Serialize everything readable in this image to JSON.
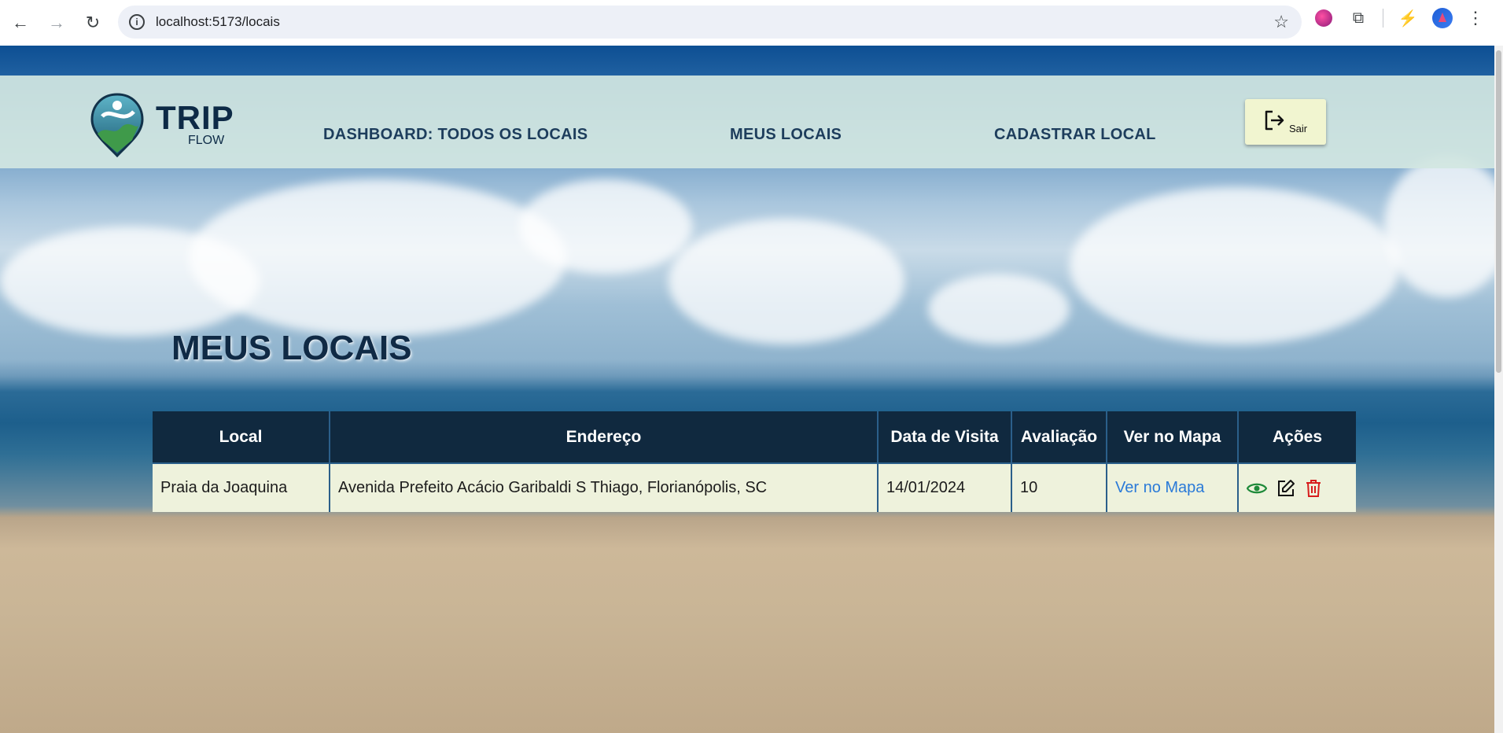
{
  "browser": {
    "url": "localhost:5173/locais",
    "back_icon": "arrow-left-icon",
    "forward_icon": "arrow-right-icon",
    "reload_icon": "reload-icon"
  },
  "header": {
    "logo_title": "TRIP",
    "logo_subtitle": "FLOW",
    "nav": [
      {
        "label": "DASHBOARD: TODOS OS LOCAIS"
      },
      {
        "label": "MEUS LOCAIS"
      },
      {
        "label": "CADASTRAR LOCAL"
      }
    ],
    "logout_label": "Sair"
  },
  "main": {
    "title": "MEUS LOCAIS",
    "table": {
      "headers": [
        "Local",
        "Endereço",
        "Data de Visita",
        "Avaliação",
        "Ver no Mapa",
        "Ações"
      ],
      "rows": [
        {
          "local": "Praia da Joaquina",
          "endereco": "Avenida Prefeito Acácio Garibaldi S Thiago, Florianópolis, SC",
          "data": "14/01/2024",
          "avaliacao": "10",
          "mapa": "Ver no Mapa"
        }
      ]
    }
  },
  "colors": {
    "header_bg": "#d2e6e1",
    "table_header": "#10293f",
    "row_bg": "#eef2dc",
    "link": "#2a7ad8",
    "view_icon": "#1f8a3a",
    "delete_icon": "#d71c1c"
  }
}
